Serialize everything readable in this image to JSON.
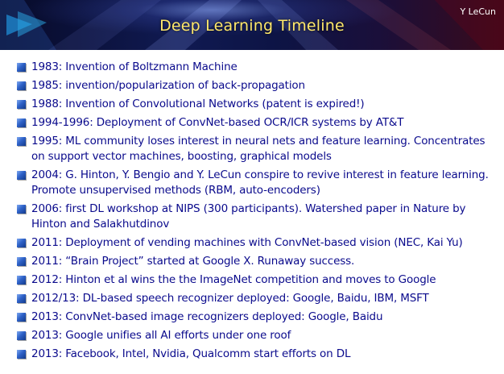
{
  "header": {
    "title": "Deep Learning Timeline",
    "author": "Y LeCun"
  },
  "items": [
    {
      "text": "1983: Invention of Boltzmann Machine"
    },
    {
      "text": "1985: invention/popularization of back-propagation"
    },
    {
      "text": "1988: Invention of Convolutional Networks (patent is expired!)"
    },
    {
      "text": "1994-1996: Deployment of ConvNet-based OCR/ICR systems by AT&T"
    },
    {
      "text": "1995: ML community loses interest in neural nets and feature learning. Concentrates on support vector machines, boosting, graphical models"
    },
    {
      "text": "2004: G. Hinton, Y. Bengio and Y. LeCun conspire to revive interest in feature learning. Promote unsupervised methods (RBM, auto-encoders)"
    },
    {
      "text": "2006: first DL workshop at NIPS (300 participants). Watershed paper in Nature by Hinton and Salakhutdinov"
    },
    {
      "text": "2011: Deployment of vending machines with ConvNet-based vision (NEC, Kai Yu)"
    },
    {
      "text": "2011: “Brain Project” started at Google X. Runaway success."
    },
    {
      "text": "2012: Hinton et al wins the the ImageNet competition and moves to Google"
    },
    {
      "text": "2012/13: DL-based speech recognizer deployed: Google, Baidu, IBM, MSFT"
    },
    {
      "text": "2013: ConvNet-based image recognizers deployed: Google, Baidu"
    },
    {
      "text": "2013: Google unifies all AI efforts under one roof"
    },
    {
      "text": "2013: Facebook, Intel, Nvidia, Qualcomm start efforts on DL"
    }
  ]
}
